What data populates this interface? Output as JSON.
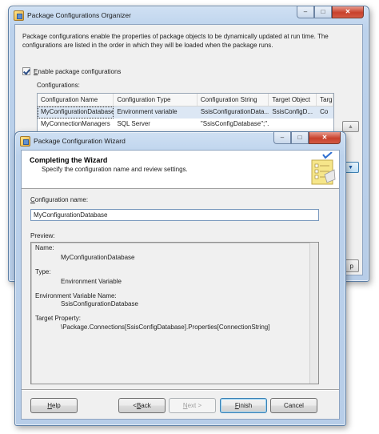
{
  "organizer": {
    "title": "Package Configurations Organizer",
    "description": "Package configurations enable the properties of package objects to be dynamically updated at run time. The configurations are listed in the order in which they will be loaded when the package runs.",
    "enable_label": "Enable package configurations",
    "enable_checked": true,
    "configurations_label": "Configurations:",
    "columns": [
      "Configuration Name",
      "Configuration Type",
      "Configuration String",
      "Target Object",
      "Targ"
    ],
    "rows": [
      [
        "MyConfigurationDatabase",
        "Environment variable",
        "SsisConfigurationData...",
        "SsisConfigD...",
        "Co"
      ],
      [
        "MyConnectionManagers",
        "SQL Server",
        "\"SsisConfigDatabase\";\"...",
        "",
        ""
      ]
    ],
    "up_icon": "arrow-up-icon",
    "down_icon": "arrow-down-icon",
    "partial_button_label": "p"
  },
  "wizard": {
    "title": "Package Configuration Wizard",
    "header_title": "Completing the Wizard",
    "header_subtitle": "Specify the configuration name and review settings.",
    "name_label": "Configuration name:",
    "name_value": "MyConfigurationDatabase",
    "preview_label": "Preview:",
    "preview": {
      "name_heading": "Name:",
      "name_value": "MyConfigurationDatabase",
      "type_heading": "Type:",
      "type_value": "Environment Variable",
      "env_heading": "Environment Variable Name:",
      "env_value": "SsisConfigurationDatabase",
      "target_heading": "Target Property:",
      "target_value": "\\Package.Connections[SsisConfigDatabase].Properties[ConnectionString]"
    },
    "buttons": {
      "help": "Help",
      "back": "< Back",
      "next": "Next >",
      "finish": "Finish",
      "cancel": "Cancel"
    }
  },
  "caption_buttons": {
    "minimize": "–",
    "maximize": "□",
    "close": "✕"
  }
}
